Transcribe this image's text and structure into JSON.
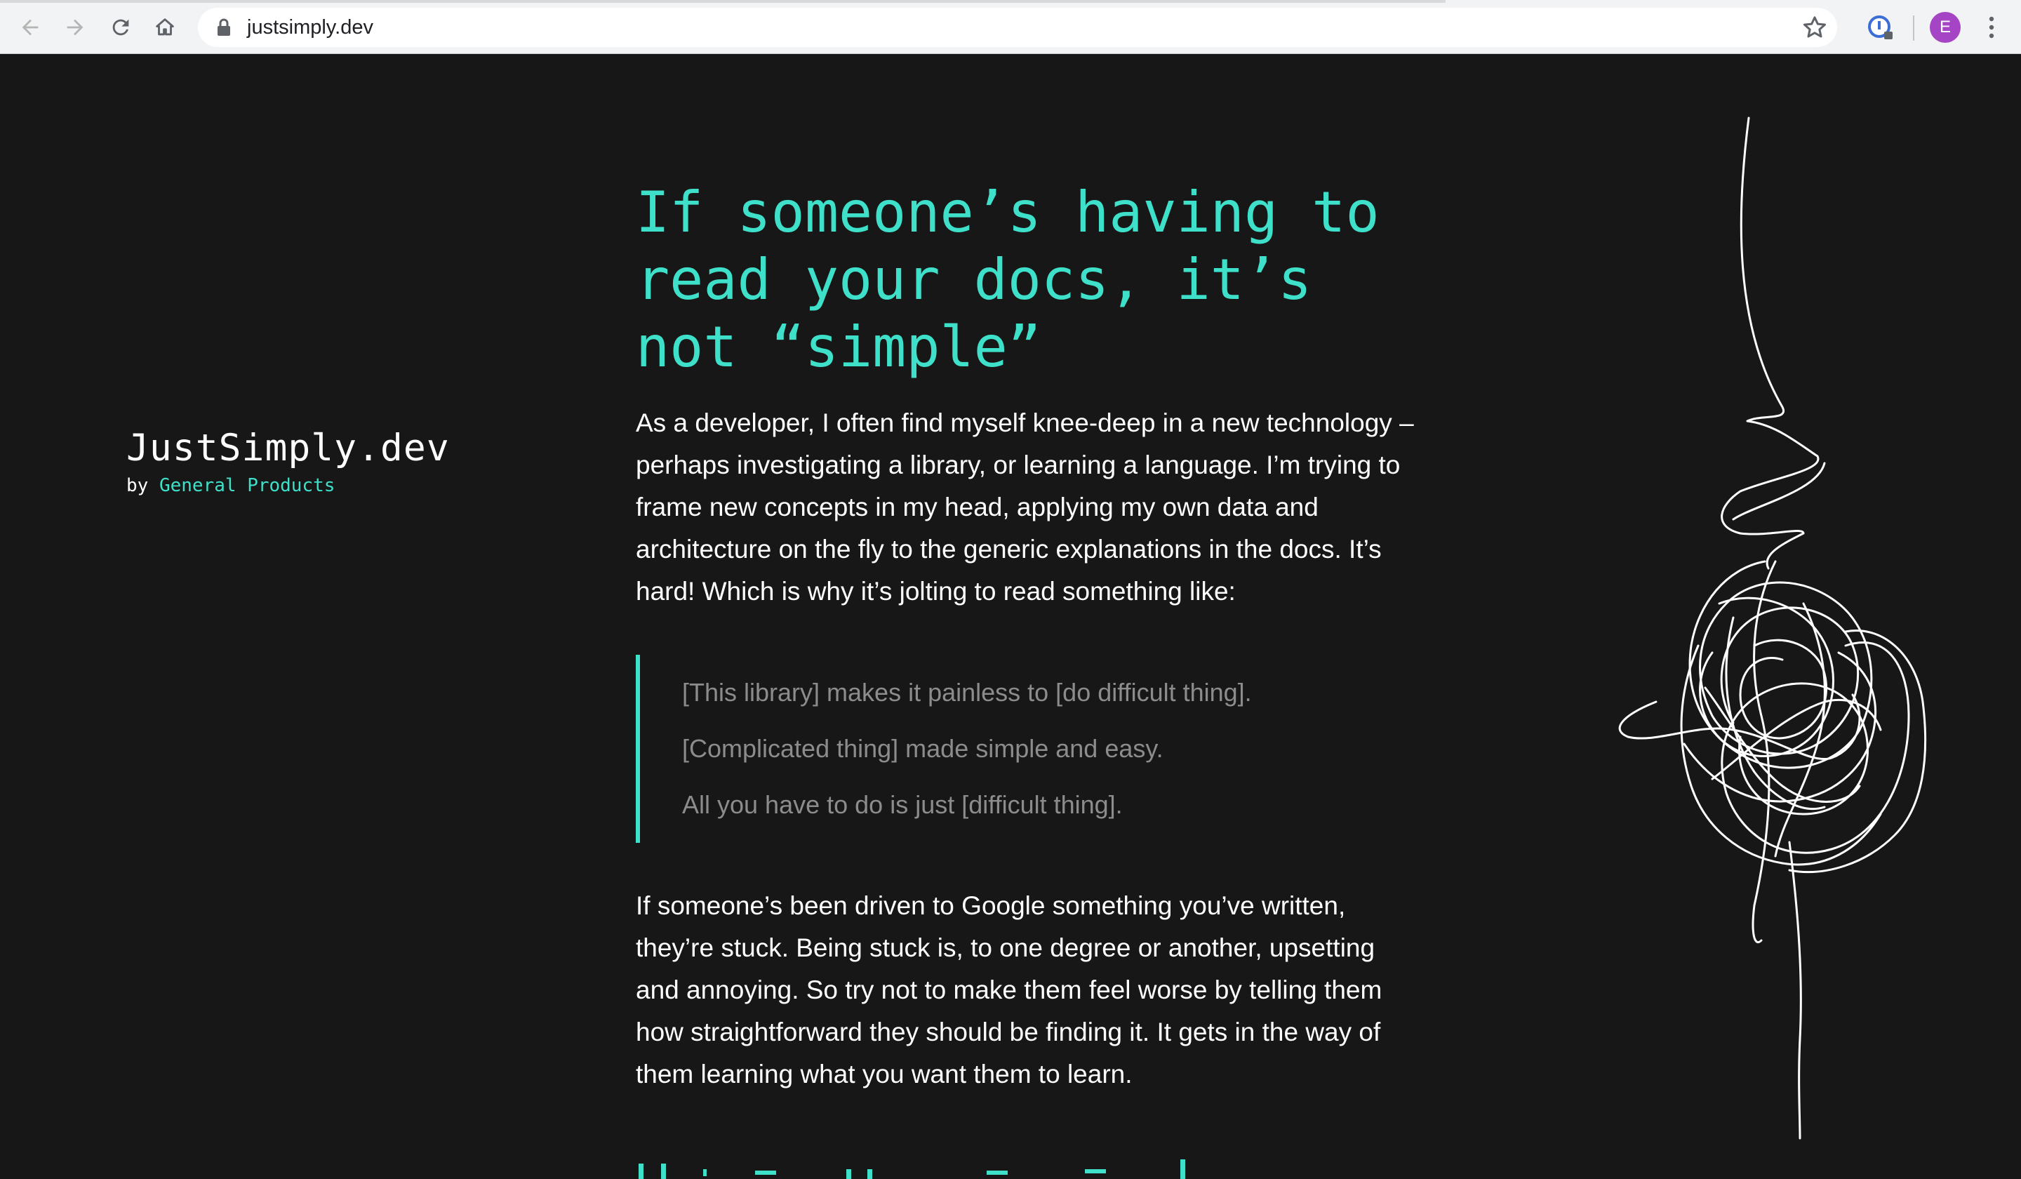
{
  "browser": {
    "url": "justsimply.dev",
    "avatar_letter": "E",
    "back_icon": "arrow-left",
    "forward_icon": "arrow-right",
    "reload_icon": "reload",
    "home_icon": "home",
    "lock_icon": "lock",
    "bookmark_icon": "star",
    "extension_icon": "extension-badge",
    "menu_icon": "vertical-ellipsis"
  },
  "brand": {
    "title": "JustSimply.dev",
    "by": "by ",
    "org": "General Products"
  },
  "article": {
    "headline": "If someone’s having to read your docs, it’s not “simple”",
    "intro": "As a developer, I often find myself knee-deep in a new technology – perhaps investigating a library, or learning a language. I’m trying to frame new concepts in my head, applying my own data and architecture on the fly to the generic explanations in the docs. It’s hard! Which is why it’s jolting to read something like:",
    "quotes": [
      "[This library] makes it painless to [do difficult thing].",
      "[Complicated thing] made simple and easy.",
      "All you have to do is just [difficult thing]."
    ],
    "body": "If someone’s been driven to Google something you’ve written, they’re stuck. Being stuck is, to one degree or another, upsetting and annoying. So try not to make them feel worse by telling them how straightforward they should be finding it. It gets in the way of them learning what you want them to learn."
  },
  "colors": {
    "background": "#171717",
    "accent": "#3ee0c9",
    "text": "#ffffff",
    "quote_text": "#8c8c8c",
    "avatar": "#a545c6"
  }
}
